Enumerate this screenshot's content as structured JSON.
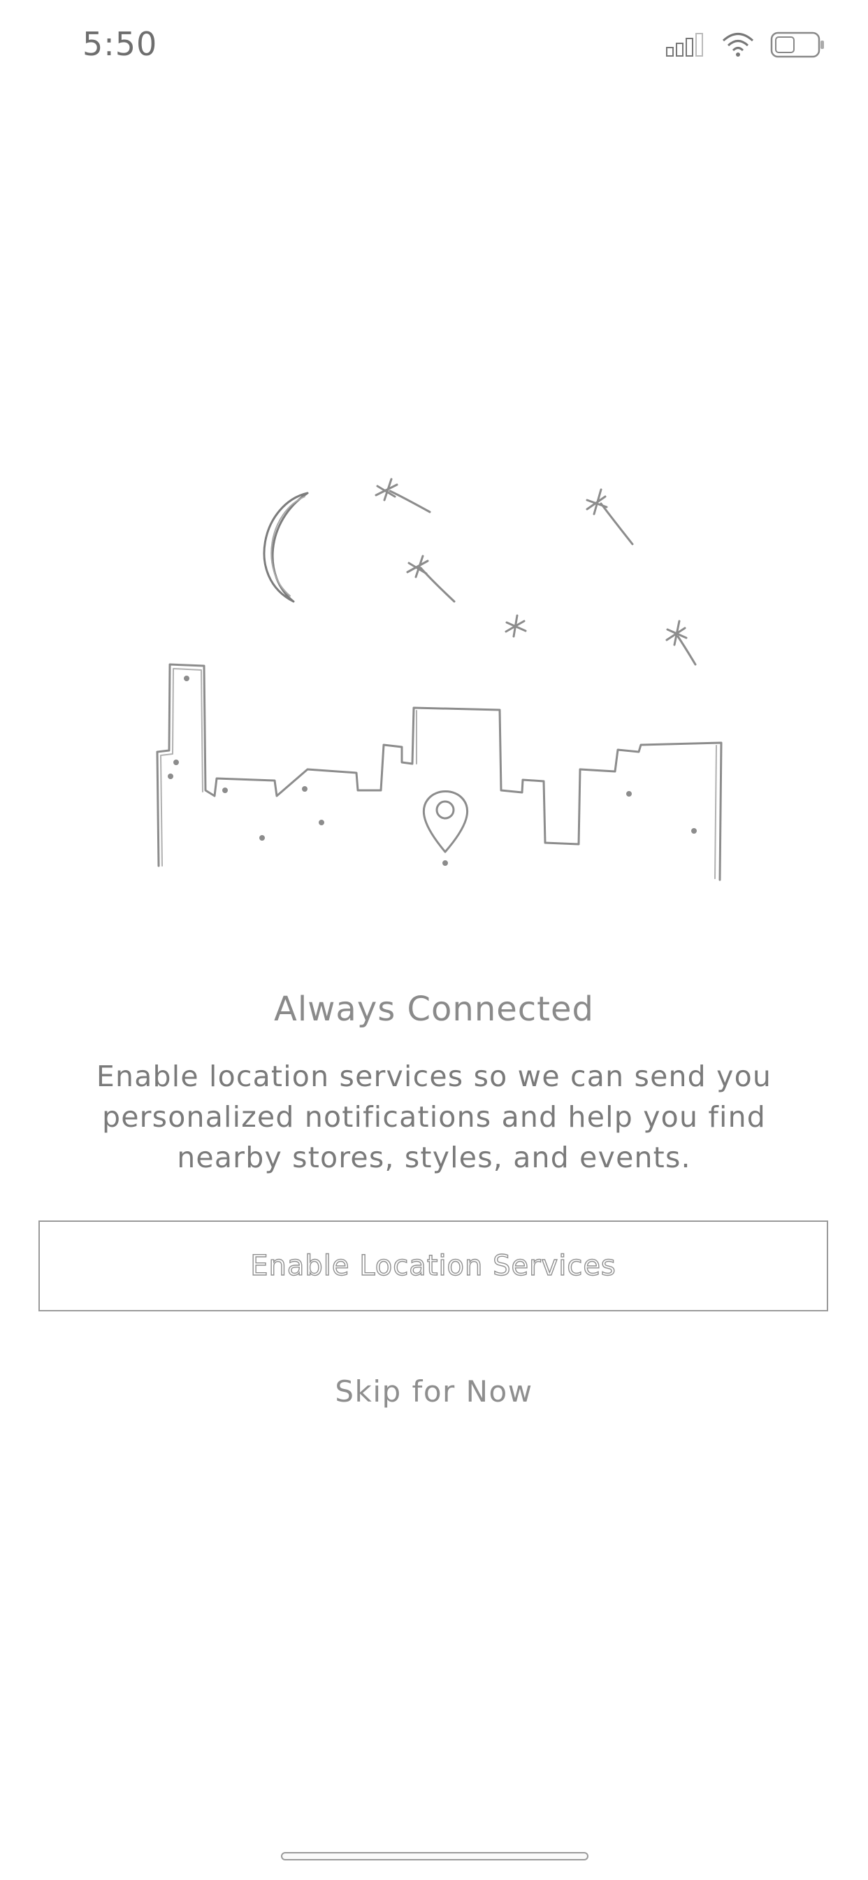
{
  "status_bar": {
    "time": "5:50",
    "icons": [
      "cellular-signal-icon",
      "wifi-icon",
      "battery-icon"
    ]
  },
  "illustration": {
    "name": "city-skyline-night-sketch",
    "elements": [
      "moon-icon",
      "star-icon",
      "location-pin-icon"
    ]
  },
  "onboarding": {
    "title": "Always Connected",
    "description": "Enable location services so we can send you personalized notifications and help you find nearby stores, styles, and events.",
    "primary_button_label": "Enable Location Services",
    "secondary_link_label": "Skip for Now"
  },
  "colors": {
    "background": "#ffffff",
    "text_primary": "#8a8a8a",
    "text_secondary": "#7a7a7a",
    "border": "#9a9a9a"
  }
}
